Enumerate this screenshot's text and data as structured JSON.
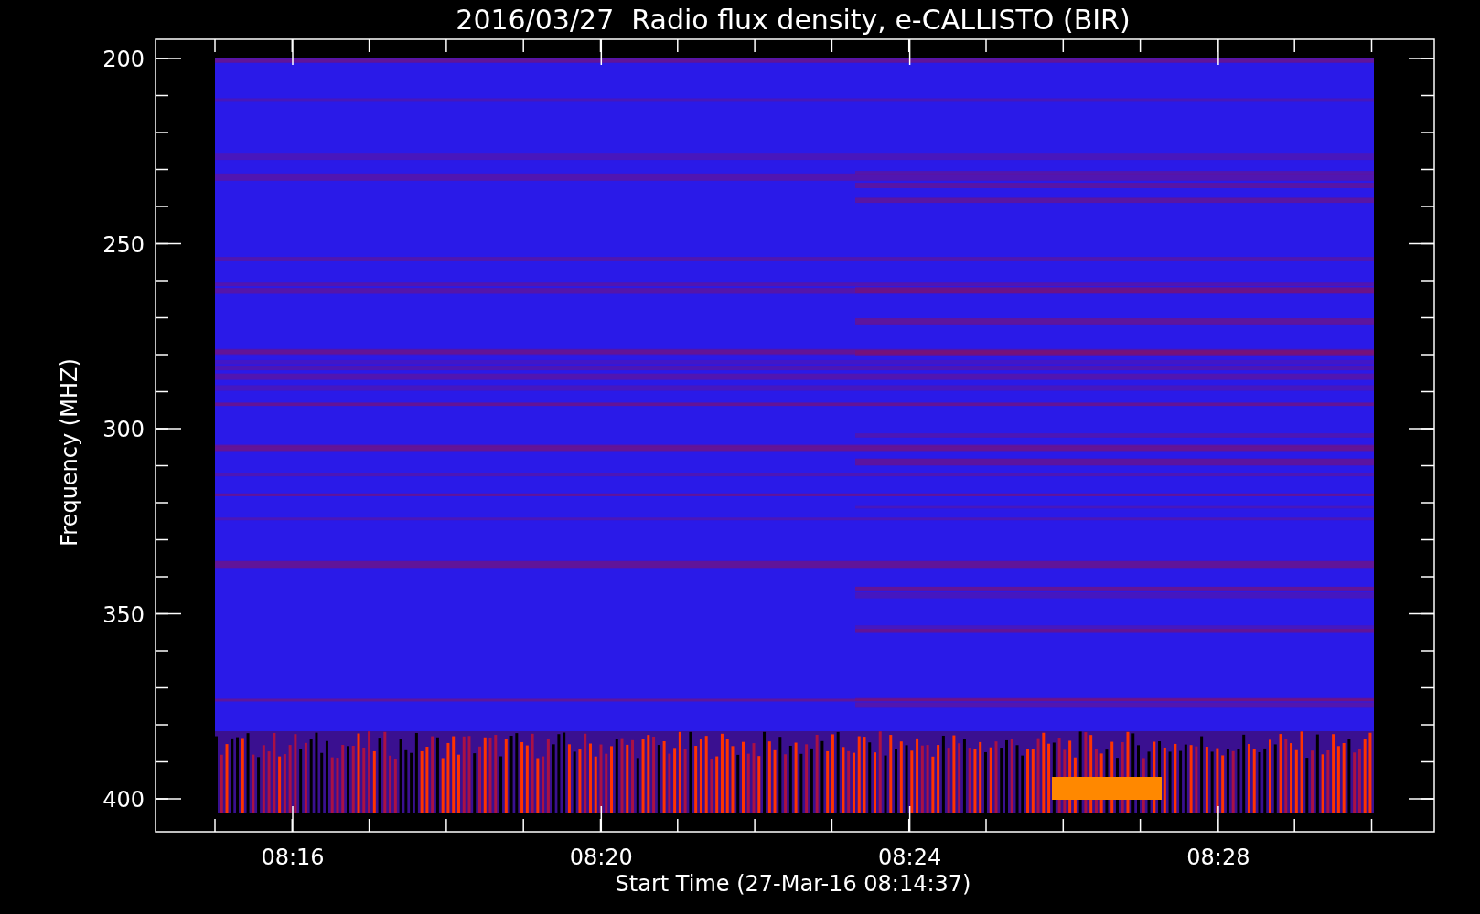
{
  "title": "2016/03/27  Radio flux density, e-CALLISTO (BIR)",
  "y_axis": {
    "title": "Frequency (MHZ)",
    "tick_labels": [
      "200",
      "250",
      "300",
      "350",
      "400"
    ]
  },
  "x_axis": {
    "title": "Start Time (27-Mar-16 08:14:37)",
    "tick_labels": [
      "08:16",
      "08:20",
      "08:24",
      "08:28"
    ]
  }
}
